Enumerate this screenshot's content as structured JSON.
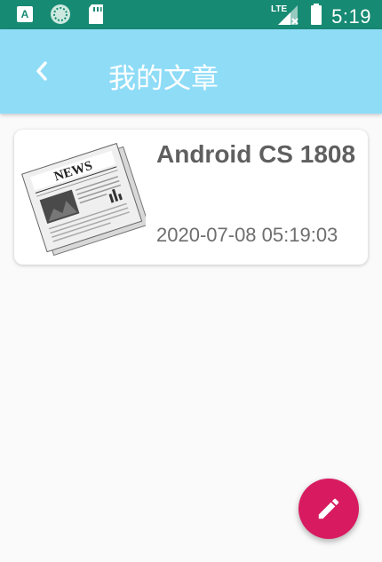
{
  "status_bar": {
    "network": "LTE",
    "time": "5:19",
    "icons": [
      "a-notification-icon",
      "sync-icon",
      "sd-card-icon",
      "signal-icon",
      "battery-icon"
    ]
  },
  "app_bar": {
    "title": "我的文章",
    "back_icon": "chevron-left-icon",
    "background": "#8fdcf7"
  },
  "articles": [
    {
      "title": "Android CS 1808",
      "date": "2020-07-08 05:19:03",
      "thumbnail": "newspaper-icon"
    }
  ],
  "fab": {
    "icon": "pencil-icon",
    "color": "#d81b60"
  },
  "colors": {
    "status_bar": "#178a73",
    "background": "#fafafa"
  }
}
